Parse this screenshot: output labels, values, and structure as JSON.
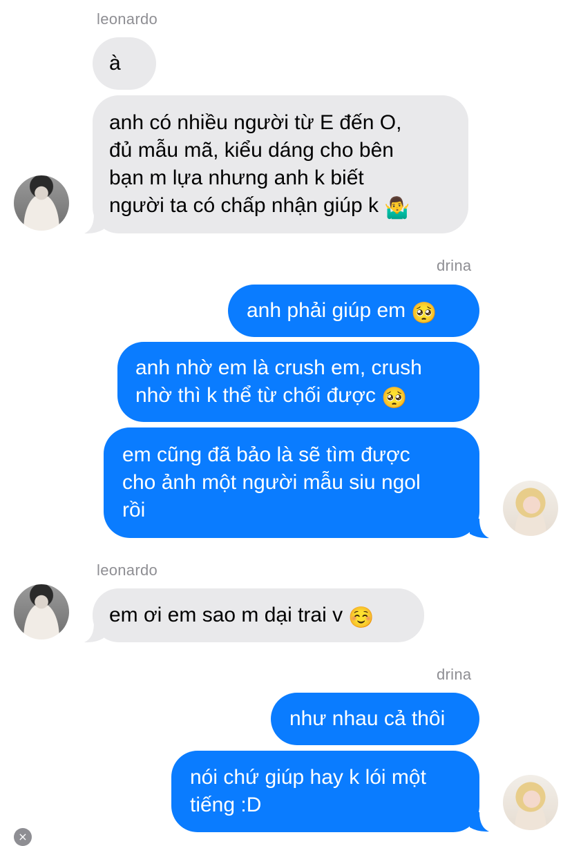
{
  "groups": [
    {
      "sender": "leonardo",
      "messages": [
        {
          "lines": [
            "à"
          ]
        },
        {
          "lines": [
            "anh có nhiều người từ E đến O,",
            "đủ mẫu mã, kiểu dáng cho bên",
            "bạn m lựa nhưng anh k biết",
            "người ta có chấp nhận giúp k"
          ],
          "emoji": "🤷‍♂️"
        }
      ]
    },
    {
      "sender": "drina",
      "messages": [
        {
          "lines": [
            "anh phải giúp em"
          ],
          "emoji": "🥺"
        },
        {
          "lines": [
            "anh nhờ em là crush em, crush",
            "nhờ thì k thể từ chối được"
          ],
          "emoji": "🥺"
        },
        {
          "lines": [
            "em cũng đã bảo là sẽ tìm được",
            "cho ảnh một người mẫu siu ngol",
            "rồi"
          ]
        }
      ]
    },
    {
      "sender": "leonardo",
      "messages": [
        {
          "lines": [
            "em ơi em sao m dại trai v"
          ],
          "emoji": "☺️"
        }
      ]
    },
    {
      "sender": "drina",
      "messages": [
        {
          "lines": [
            "như nhau cả thôi"
          ]
        },
        {
          "lines": [
            "nói chứ giúp hay k lói một",
            "tiếng :D"
          ]
        }
      ]
    }
  ],
  "colors": {
    "incoming_bubble": "#e9e9eb",
    "outgoing_bubble": "#0a7cff",
    "sender_label": "#8e8e93"
  },
  "icons": {
    "dismiss": "×"
  }
}
